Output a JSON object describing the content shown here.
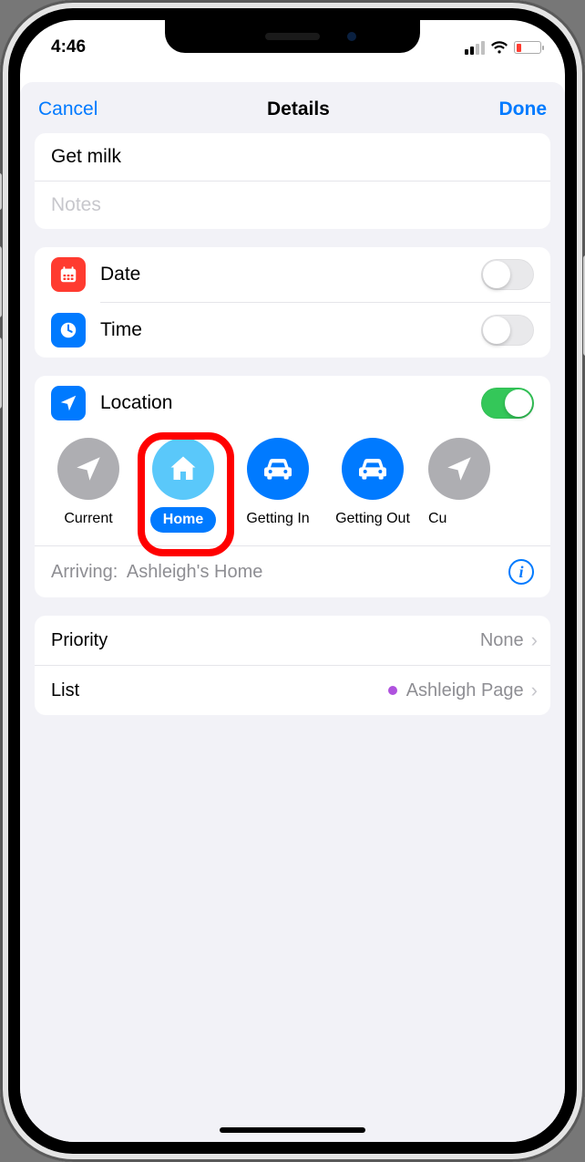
{
  "status": {
    "time": "4:46"
  },
  "nav": {
    "cancel": "Cancel",
    "title": "Details",
    "done": "Done"
  },
  "reminder": {
    "title": "Get milk",
    "notes_placeholder": "Notes"
  },
  "rows": {
    "date": "Date",
    "time": "Time",
    "location": "Location"
  },
  "toggles": {
    "date": false,
    "time": false,
    "location": true
  },
  "location_options": [
    {
      "key": "current",
      "label": "Current",
      "icon": "navigate",
      "color": "grey"
    },
    {
      "key": "home",
      "label": "Home",
      "icon": "house",
      "color": "lblue",
      "selected": true
    },
    {
      "key": "getting_in",
      "label": "Getting In",
      "icon": "car",
      "color": "blue"
    },
    {
      "key": "getting_out",
      "label": "Getting Out",
      "icon": "car",
      "color": "blue"
    },
    {
      "key": "custom",
      "label": "Cu",
      "icon": "navigate",
      "color": "grey",
      "partial": true
    }
  ],
  "arriving": {
    "prefix": "Arriving:",
    "value": "Ashleigh's Home"
  },
  "priority": {
    "label": "Priority",
    "value": "None"
  },
  "list": {
    "label": "List",
    "value": "Ashleigh Page",
    "dot_color": "#af52de"
  }
}
